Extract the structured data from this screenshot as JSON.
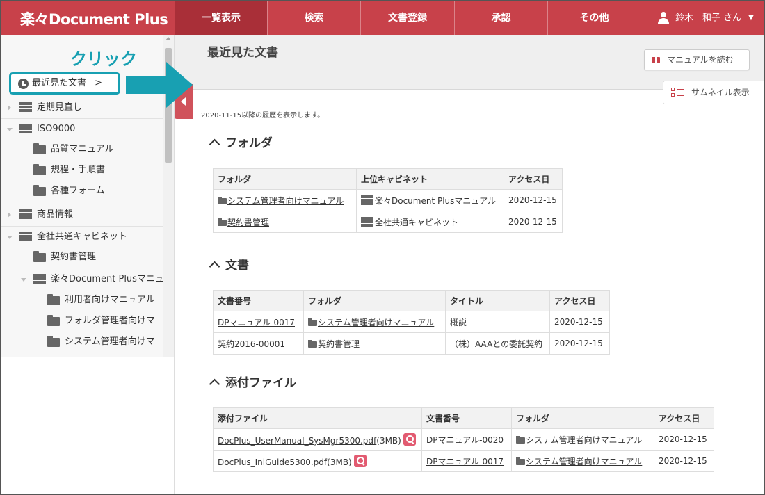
{
  "header": {
    "logo": "楽々Document Plus",
    "tabs": [
      {
        "label": "一覧表示",
        "active": true
      },
      {
        "label": "検索"
      },
      {
        "label": "文書登録"
      },
      {
        "label": "承認"
      },
      {
        "label": "その他"
      }
    ],
    "user": "鈴木　和子 さん",
    "brand_color": "#c8414a"
  },
  "sidebar": {
    "annotation": "クリック",
    "recent_button": "最近見た文書",
    "tree": [
      {
        "label": "定期見直し",
        "type": "cabinet",
        "state": "collapsed"
      },
      {
        "label": "ISO9000",
        "type": "cabinet",
        "state": "expanded"
      },
      {
        "label": "品質マニュアル",
        "type": "folder"
      },
      {
        "label": "規程・手順書",
        "type": "folder"
      },
      {
        "label": "各種フォーム",
        "type": "folder"
      },
      {
        "label": "商品情報",
        "type": "cabinet",
        "state": "collapsed"
      },
      {
        "label": "全社共通キャビネット",
        "type": "cabinet",
        "state": "expanded"
      },
      {
        "label": "契約書管理",
        "type": "folder"
      },
      {
        "label": "楽々Document Plusマニュ",
        "type": "cabinet",
        "state": "expanded"
      },
      {
        "label": "利用者向けマニュアル",
        "type": "folder"
      },
      {
        "label": "フォルダ管理者向けマ",
        "type": "folder"
      },
      {
        "label": "システム管理者向けマ",
        "type": "folder"
      }
    ],
    "accent_color": "#18a0b2"
  },
  "main": {
    "title": "最近見た文書",
    "manual_button": "マニュアルを読む",
    "thumbnail_button": "サムネイル表示",
    "history_note": "2020-11-15以降の履歴を表示します。",
    "folders": {
      "heading": "フォルダ",
      "columns": [
        "フォルダ",
        "上位キャビネット",
        "アクセス日"
      ],
      "rows": [
        [
          "システム管理者向けマニュアル",
          "楽々Document Plusマニュアル",
          "2020-12-15"
        ],
        [
          "契約書管理",
          "全社共通キャビネット",
          "2020-12-15"
        ]
      ]
    },
    "documents": {
      "heading": "文書",
      "columns": [
        "文書番号",
        "フォルダ",
        "タイトル",
        "アクセス日"
      ],
      "rows": [
        [
          "DPマニュアル-0017",
          "システム管理者向けマニュアル",
          "概説",
          "2020-12-15"
        ],
        [
          "契約2016-00001",
          "契約書管理",
          "（株）AAAとの委託契約",
          "2020-12-15"
        ]
      ]
    },
    "attachments": {
      "heading": "添付ファイル",
      "columns": [
        "添付ファイル",
        "文書番号",
        "フォルダ",
        "アクセス日"
      ],
      "rows": [
        [
          "DocPlus_UserManual_SysMgr5300.pdf",
          "(3MB)",
          "DPマニュアル-0020",
          "システム管理者向けマニュアル",
          "2020-12-15"
        ],
        [
          "DocPlus_IniGuide5300.pdf",
          "(3MB)",
          "DPマニュアル-0017",
          "システム管理者向けマニュアル",
          "2020-12-15"
        ]
      ]
    }
  }
}
